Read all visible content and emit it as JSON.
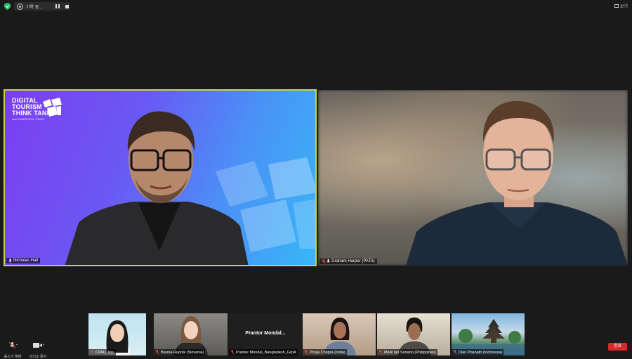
{
  "topbar": {
    "recording_label": "기록 중...",
    "view_label": "보기"
  },
  "speaker": {
    "name": "Nicholas Hall",
    "logo": {
      "line1": "DIGITAL",
      "line2": "TOURISM",
      "line3": "THINK TANK",
      "url": "www.THINKDIGITAL.TRAVEL"
    }
  },
  "other_video": {
    "name": "Graham Harper (PATA)"
  },
  "gallery": [
    {
      "name": "CPAU Jeju"
    },
    {
      "name": "Blazka Rupnik (Slovenia)"
    },
    {
      "name": "Prantor Mondal_Bangladesh_GrpA",
      "center_label": "Prantor  Mondal..."
    },
    {
      "name": "Pooja Chopra (India)"
    },
    {
      "name": "Mark Ian Soriano (Philippines)"
    },
    {
      "name": "Dian Prianatri (Indonesia)"
    }
  ],
  "controls": {
    "audio_label": "음소거 해제",
    "video_label": "비디오 중지",
    "end_label": "종료"
  },
  "colors": {
    "active_speaker_border": "#c3d83a",
    "end_button": "#d42a2a",
    "muted_mic": "#e0483c"
  }
}
